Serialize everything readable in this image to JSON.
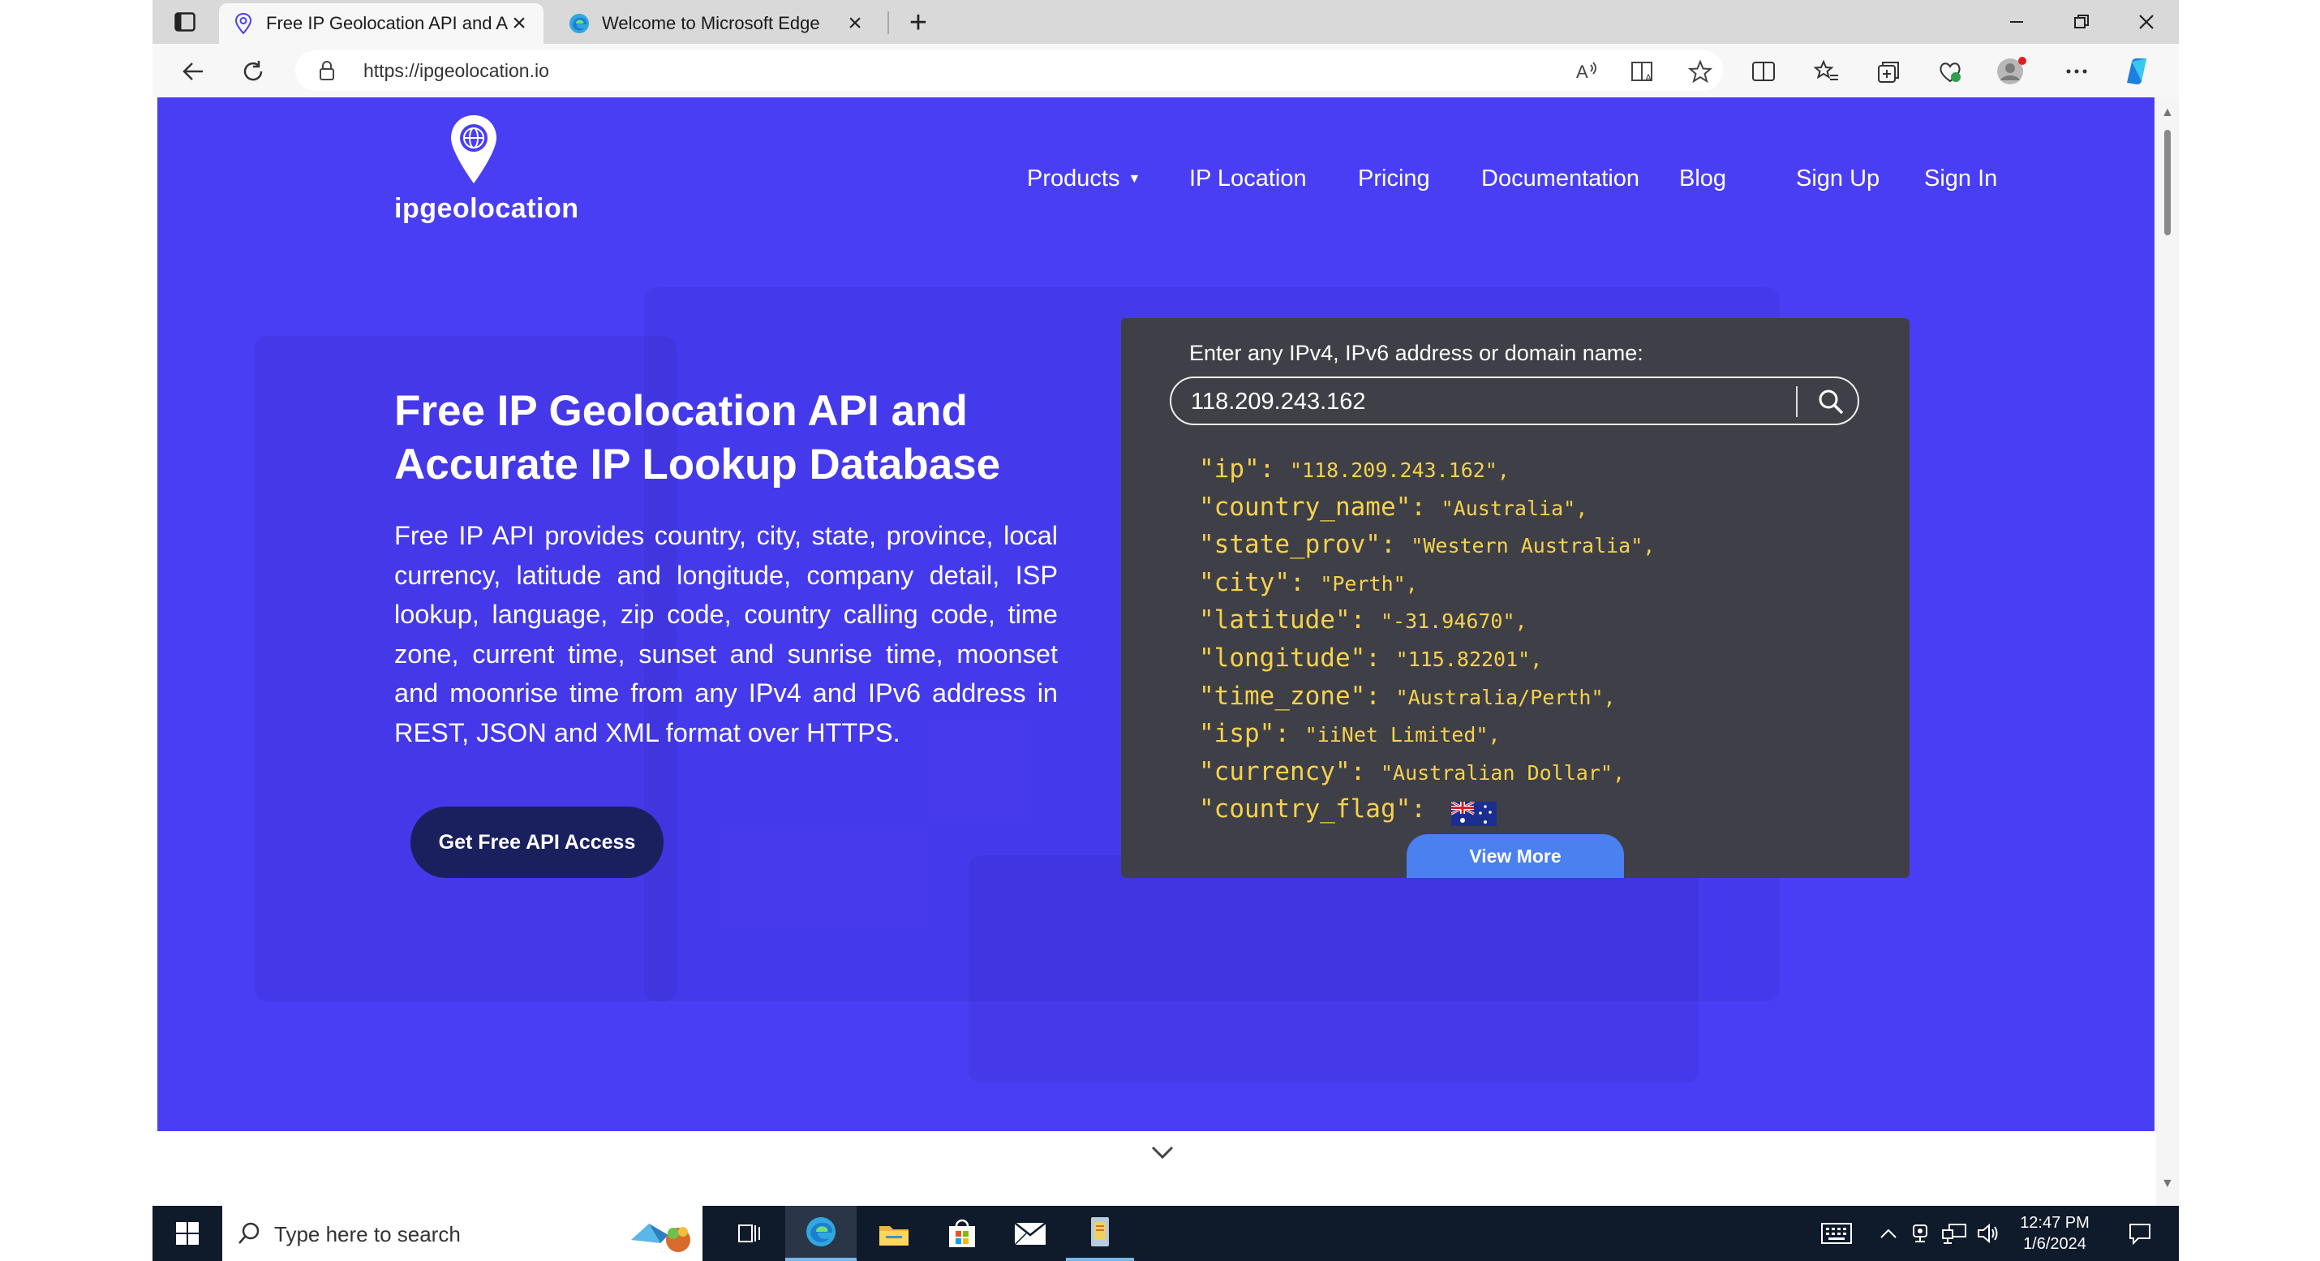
{
  "browser": {
    "tabs": [
      {
        "title": "Free IP Geolocation API and Accu",
        "active": true,
        "icon": "pin-icon"
      },
      {
        "title": "Welcome to Microsoft Edge",
        "active": false,
        "icon": "edge-icon"
      }
    ],
    "url": "https://ipgeolocation.io"
  },
  "site": {
    "brand": "ipgeolocation",
    "nav": {
      "products": "Products",
      "ip_location": "IP Location",
      "pricing": "Pricing",
      "documentation": "Documentation",
      "blog": "Blog",
      "sign_up": "Sign Up",
      "sign_in": "Sign In"
    },
    "hero": {
      "title": "Free IP Geolocation API and Accurate IP Lookup Database",
      "description": "Free IP API provides country, city, state, province, local currency, latitude and longitude, company detail, ISP lookup, language, zip code, country calling code, time zone, current time, sunset and sunrise time, moonset and moonrise time from any IPv4 and IPv6 address in REST, JSON and XML format over HTTPS.",
      "cta": "Get Free API Access"
    },
    "lookup": {
      "prompt": "Enter any IPv4, IPv6 address or domain name:",
      "input_value": "118.209.243.162",
      "result": [
        {
          "key": "\"ip\": ",
          "value": "\"118.209.243.162\","
        },
        {
          "key": "\"country_name\": ",
          "value": "\"Australia\","
        },
        {
          "key": "\"state_prov\": ",
          "value": "\"Western Australia\","
        },
        {
          "key": "\"city\": ",
          "value": "\"Perth\","
        },
        {
          "key": "\"latitude\": ",
          "value": "\"-31.94670\","
        },
        {
          "key": "\"longitude\": ",
          "value": "\"115.82201\","
        },
        {
          "key": "\"time_zone\": ",
          "value": "\"Australia/Perth\","
        },
        {
          "key": "\"isp\": ",
          "value": "\"iiNet Limited\","
        },
        {
          "key": "\"currency\": ",
          "value": "\"Australian Dollar\","
        },
        {
          "key": "\"country_flag\": ",
          "value": ""
        }
      ],
      "view_more": "View More"
    }
  },
  "taskbar": {
    "search_placeholder": "Type here to search",
    "time": "12:47 PM",
    "date": "1/6/2024"
  },
  "colors": {
    "brand_blue": "#4a3ef5",
    "cta_navy": "#1a1f5e",
    "panel_dark": "#3f3f48",
    "json_yellow": "#f5d24c",
    "view_more_blue": "#4a80f0"
  }
}
